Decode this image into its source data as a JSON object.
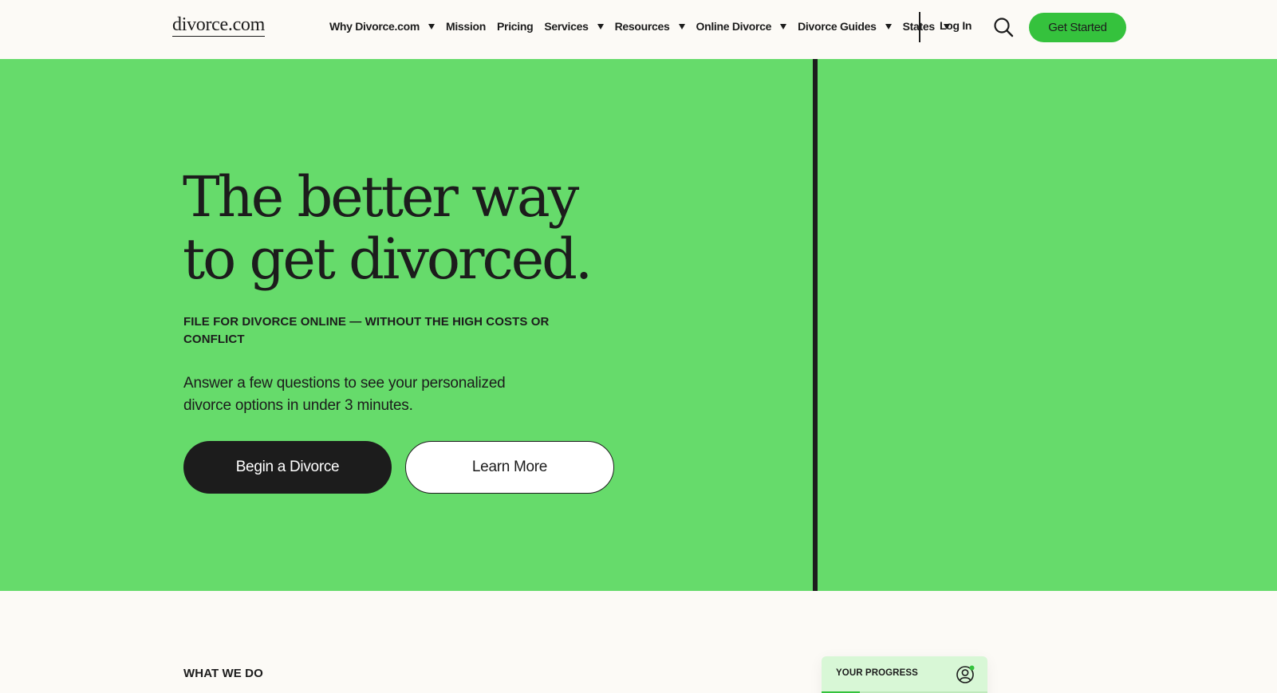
{
  "header": {
    "logo": "divorce.com",
    "nav": [
      {
        "label": "Why Divorce.com",
        "has_dropdown": true
      },
      {
        "label": "Mission",
        "has_dropdown": false
      },
      {
        "label": "Pricing",
        "has_dropdown": false
      },
      {
        "label": "Services",
        "has_dropdown": true
      },
      {
        "label": "Resources",
        "has_dropdown": true
      },
      {
        "label": "Online Divorce",
        "has_dropdown": true
      },
      {
        "label": "Divorce Guides",
        "has_dropdown": true
      },
      {
        "label": "States",
        "has_dropdown": true
      }
    ],
    "login_label": "Log In",
    "search_icon": "search-icon",
    "cta_label": "Get Started"
  },
  "hero": {
    "title": "The better way to get divorced.",
    "eyebrow": "FILE FOR DIVORCE ONLINE — WITHOUT THE HIGH COSTS OR CONFLICT",
    "description": "Answer a few questions to see your personalized divorce options in under 3 minutes.",
    "primary_button": "Begin a Divorce",
    "secondary_button": "Learn More"
  },
  "what_we_do": {
    "label": "WHAT WE DO"
  },
  "progress_card": {
    "label": "YOUR PROGRESS",
    "icon": "user-icon",
    "progress_fraction": 0.23
  },
  "colors": {
    "hero_bg": "#66db6b",
    "accent": "#35c23d",
    "dark": "#1c1c1c",
    "page_bg": "#fcfaf6"
  }
}
